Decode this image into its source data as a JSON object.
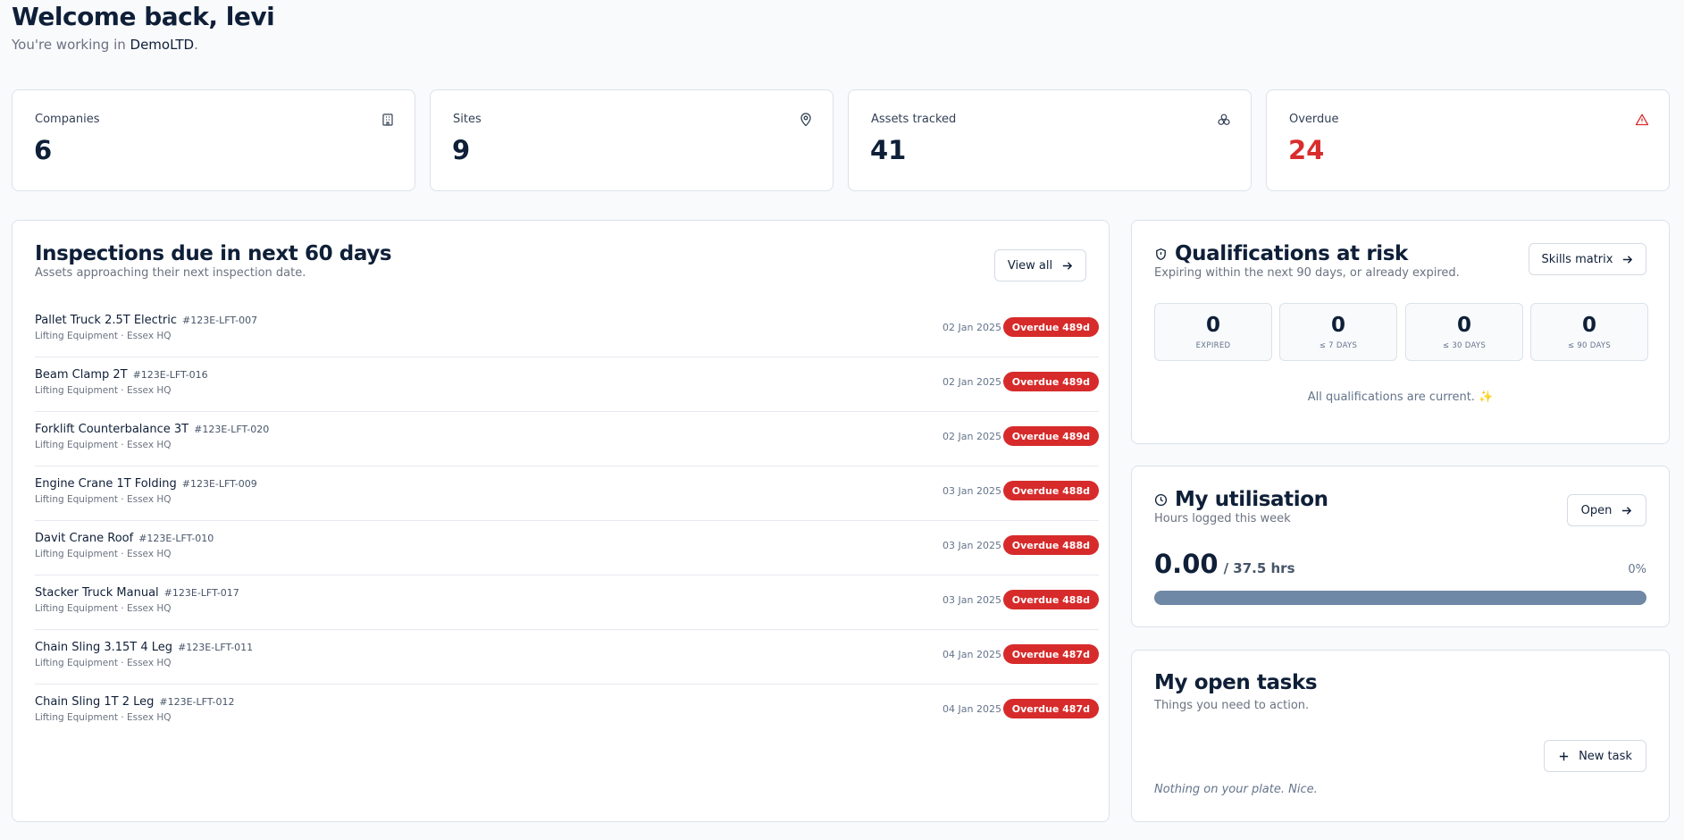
{
  "header": {
    "welcome": "Welcome back, levi",
    "working_prefix": "You're working in",
    "company": "DemoLTD",
    "working_suffix": "."
  },
  "stats": [
    {
      "title": "Companies",
      "value": "6",
      "icon": "building-icon"
    },
    {
      "title": "Sites",
      "value": "9",
      "icon": "map-pin-icon"
    },
    {
      "title": "Assets tracked",
      "value": "41",
      "icon": "boxes-icon"
    },
    {
      "title": "Overdue",
      "value": "24",
      "icon": "alert-triangle-icon",
      "color": "#d92d2d"
    }
  ],
  "inspections": {
    "title": "Inspections due in next 60 days",
    "subtitle": "Assets approaching their next inspection date.",
    "view_all": "View all",
    "items": [
      {
        "name": "Pallet Truck 2.5T Electric",
        "tag": "#123E-LFT-007",
        "location": "Lifting Equipment · Essex HQ",
        "date": "02 Jan 2025",
        "status": "Overdue 489d"
      },
      {
        "name": "Beam Clamp 2T",
        "tag": "#123E-LFT-016",
        "location": "Lifting Equipment · Essex HQ",
        "date": "02 Jan 2025",
        "status": "Overdue 489d"
      },
      {
        "name": "Forklift Counterbalance 3T",
        "tag": "#123E-LFT-020",
        "location": "Lifting Equipment · Essex HQ",
        "date": "02 Jan 2025",
        "status": "Overdue 489d"
      },
      {
        "name": "Engine Crane 1T Folding",
        "tag": "#123E-LFT-009",
        "location": "Lifting Equipment · Essex HQ",
        "date": "03 Jan 2025",
        "status": "Overdue 488d"
      },
      {
        "name": "Davit Crane Roof",
        "tag": "#123E-LFT-010",
        "location": "Lifting Equipment · Essex HQ",
        "date": "03 Jan 2025",
        "status": "Overdue 488d"
      },
      {
        "name": "Stacker Truck Manual",
        "tag": "#123E-LFT-017",
        "location": "Lifting Equipment · Essex HQ",
        "date": "03 Jan 2025",
        "status": "Overdue 488d"
      },
      {
        "name": "Chain Sling 3.15T 4 Leg",
        "tag": "#123E-LFT-011",
        "location": "Lifting Equipment · Essex HQ",
        "date": "04 Jan 2025",
        "status": "Overdue 487d"
      },
      {
        "name": "Chain Sling 1T 2 Leg",
        "tag": "#123E-LFT-012",
        "location": "Lifting Equipment · Essex HQ",
        "date": "04 Jan 2025",
        "status": "Overdue 487d"
      }
    ]
  },
  "qualifications": {
    "title": "Qualifications at risk",
    "subtitle": "Expiring within the next 90 days, or already expired.",
    "button": "Skills matrix",
    "counts": [
      {
        "value": "0",
        "label": "EXPIRED"
      },
      {
        "value": "0",
        "label": "≤ 7 DAYS"
      },
      {
        "value": "0",
        "label": "≤ 30 DAYS"
      },
      {
        "value": "0",
        "label": "≤ 90 DAYS"
      }
    ],
    "message": "All qualifications are current. ✨"
  },
  "utilisation": {
    "title": "My utilisation",
    "subtitle": "Hours logged this week",
    "button": "Open",
    "hours": "0.00",
    "target": "/ 37.5 hrs",
    "percent": "0%"
  },
  "tasks": {
    "title": "My open tasks",
    "subtitle": "Things you need to action.",
    "button": "New task",
    "empty": "Nothing on your plate. Nice."
  }
}
